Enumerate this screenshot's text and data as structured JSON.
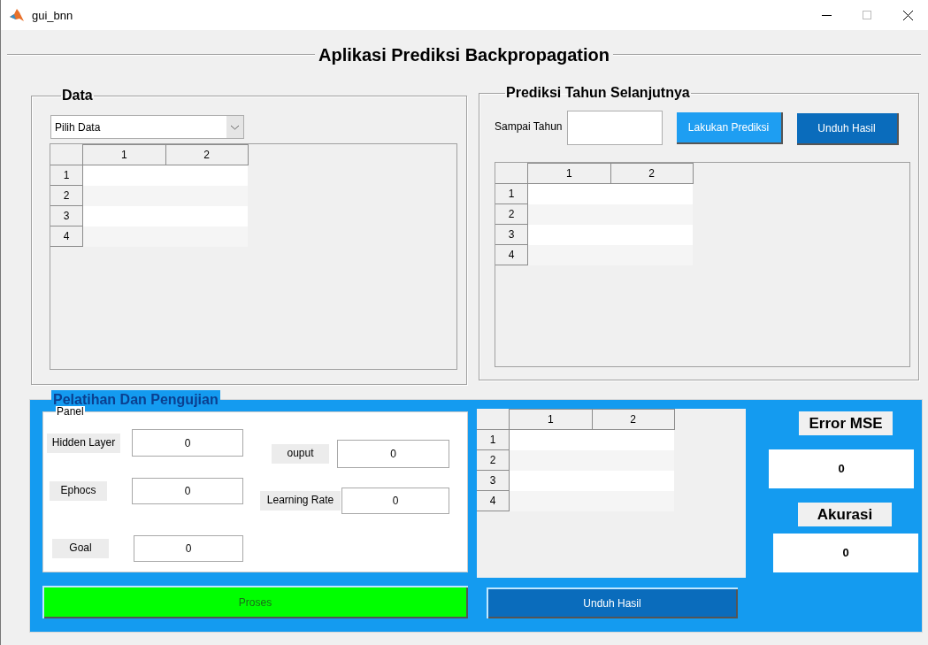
{
  "window": {
    "title": "gui_bnn"
  },
  "heading": "Aplikasi Prediksi Backpropagation",
  "data_panel": {
    "title": "Data",
    "dropdown": {
      "value": "Pilih Data"
    },
    "table": {
      "columns": [
        "1",
        "2"
      ],
      "rows": [
        "1",
        "2",
        "3",
        "4"
      ]
    }
  },
  "prediction_panel": {
    "title": "Prediksi Tahun Selanjutnya",
    "year_field": {
      "label": "Sampai Tahun"
    },
    "buttons": [
      {
        "label": "Lakukan Prediksi",
        "kind": "light"
      },
      {
        "label": "Unduh Hasil",
        "kind": "dark"
      }
    ],
    "table": {
      "columns": [
        "1",
        "2"
      ],
      "rows": [
        "1",
        "2",
        "3",
        "4"
      ]
    }
  },
  "training_panel": {
    "title": "Pelatihan Dan Pengujian",
    "panel_title": "Panel",
    "fields_left": [
      {
        "label": "Hidden Layer",
        "value": "0"
      },
      {
        "label": "Ephocs",
        "value": "0"
      },
      {
        "label": "Goal",
        "value": "0"
      }
    ],
    "fields_right": [
      {
        "label": "ouput",
        "value": "0"
      },
      {
        "label": "Learning Rate",
        "value": "0"
      }
    ],
    "table": {
      "columns": [
        "1",
        "2"
      ],
      "rows": [
        "1",
        "2",
        "3",
        "4"
      ]
    },
    "metrics": [
      {
        "label": "Error MSE",
        "value": "0"
      },
      {
        "label": "Akurasi",
        "value": "0"
      }
    ],
    "buttons": [
      {
        "label": "Proses",
        "kind": "green"
      },
      {
        "label": "Unduh Hasil",
        "kind": "dark"
      }
    ]
  }
}
